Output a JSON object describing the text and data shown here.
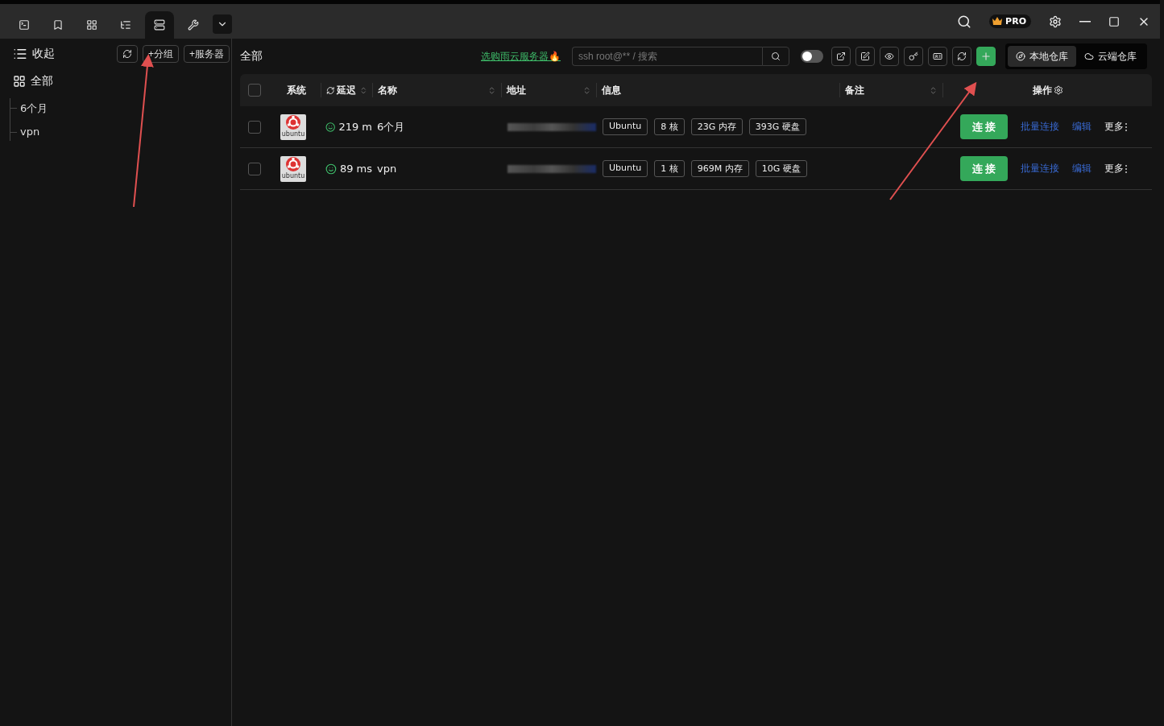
{
  "title_bar": {
    "tabs": [
      {
        "selected": false
      },
      {
        "selected": false
      },
      {
        "selected": false
      },
      {
        "selected": false
      },
      {
        "selected": true
      },
      {
        "selected": false
      }
    ],
    "pro_badge": "PRO"
  },
  "sidebar": {
    "collapse_label": "收起",
    "all_label": "全部",
    "buttons": [
      "+分组",
      "+服务器"
    ],
    "groups": [
      {
        "label": "6个月"
      },
      {
        "label": "vpn"
      }
    ]
  },
  "main": {
    "heading": "全部",
    "promo_link": "选购雨云服务器🔥",
    "search": {
      "placeholder": "ssh root@** / 搜索"
    },
    "toggle": {
      "on": false
    },
    "storage_tabs": [
      {
        "label": "本地仓库",
        "selected": true
      },
      {
        "label": "云端仓库",
        "selected": false
      }
    ]
  },
  "table": {
    "all_checked": false,
    "columns": [
      {
        "label": "系统",
        "sortable": false
      },
      {
        "label": "延迟",
        "sortable": true
      },
      {
        "label": "名称",
        "sortable": true
      },
      {
        "label": "地址",
        "sortable": true
      },
      {
        "label": "信息",
        "sortable": false
      },
      {
        "label": "备注",
        "sortable": true
      }
    ],
    "actions_label": "操作",
    "rows": [
      {
        "checked": false,
        "os_label": "ubuntu",
        "latency": "219 m",
        "name": "6个月",
        "tags": [
          "Ubuntu",
          "8 核",
          "23G 内存",
          "393G 硬盘"
        ],
        "connect": "连 接",
        "batch": "批量连接",
        "edit": "编辑",
        "more": "更多"
      },
      {
        "checked": false,
        "os_label": "ubuntu",
        "latency": "89 ms",
        "name": "vpn",
        "tags": [
          "Ubuntu",
          "1 核",
          "969M 内存",
          "10G 硬盘"
        ],
        "connect": "连 接",
        "batch": "批量连接",
        "edit": "编辑",
        "more": "更多"
      }
    ]
  }
}
